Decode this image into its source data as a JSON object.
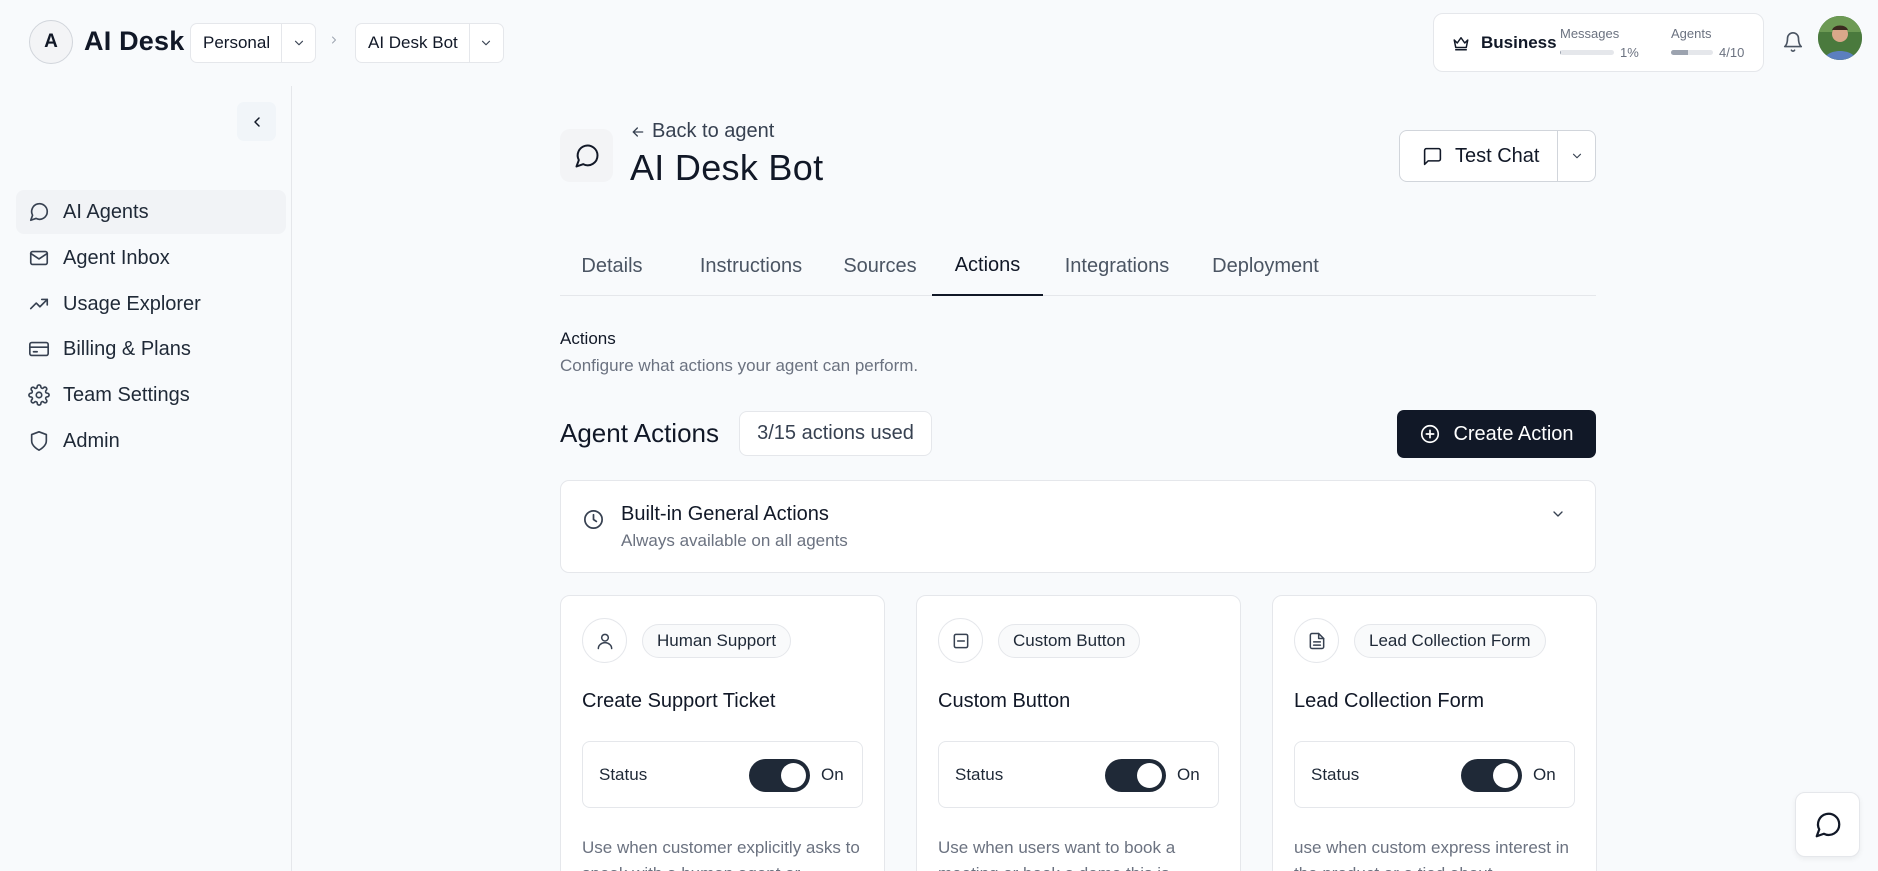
{
  "app": {
    "logo_letter": "A",
    "name": "AI Desk"
  },
  "header": {
    "workspace_select": "Personal",
    "agent_select": "AI Desk Bot",
    "plan": {
      "name": "Business",
      "messages_label": "Messages",
      "messages_value": "1%",
      "messages_fraction": 0.01,
      "agents_label": "Agents",
      "agents_value": "4/10",
      "agents_fraction": 0.4
    }
  },
  "sidebar": {
    "items": [
      {
        "label": "AI Agents",
        "icon": "message-circle-icon",
        "active": true
      },
      {
        "label": "Agent Inbox",
        "icon": "mail-icon"
      },
      {
        "label": "Usage Explorer",
        "icon": "trending-icon"
      },
      {
        "label": "Billing & Plans",
        "icon": "credit-card-icon"
      },
      {
        "label": "Team Settings",
        "icon": "gear-icon"
      },
      {
        "label": "Admin",
        "icon": "shield-icon"
      }
    ]
  },
  "agent": {
    "back_label": "Back to agent",
    "title": "AI Desk Bot",
    "test_chat_label": "Test Chat"
  },
  "tabs": [
    {
      "label": "Details"
    },
    {
      "label": "Instructions"
    },
    {
      "label": "Sources"
    },
    {
      "label": "Actions",
      "active": true
    },
    {
      "label": "Integrations"
    },
    {
      "label": "Deployment"
    }
  ],
  "section": {
    "title": "Actions",
    "subtitle": "Configure what actions your agent can perform."
  },
  "agent_actions": {
    "title": "Agent Actions",
    "usage": "3/15 actions used",
    "create_label": "Create Action"
  },
  "builtin": {
    "title": "Built-in General Actions",
    "subtitle": "Always available on all agents"
  },
  "cards": [
    {
      "tag": "Human Support",
      "icon": "user-icon",
      "title": "Create Support Ticket",
      "status_label": "Status",
      "status_value": "On",
      "enabled": true,
      "description": "Use when customer explicitly asks to speak with a human agent or"
    },
    {
      "tag": "Custom Button",
      "icon": "square-minus-icon",
      "title": "Custom Button",
      "status_label": "Status",
      "status_value": "On",
      "enabled": true,
      "description": "Use when users want to book a meeting or book a demo this is"
    },
    {
      "tag": "Lead Collection Form",
      "icon": "document-icon",
      "title": "Lead Collection Form",
      "status_label": "Status",
      "status_value": "On",
      "enabled": true,
      "description": "use when custom express interest in the product or a tied about"
    }
  ]
}
